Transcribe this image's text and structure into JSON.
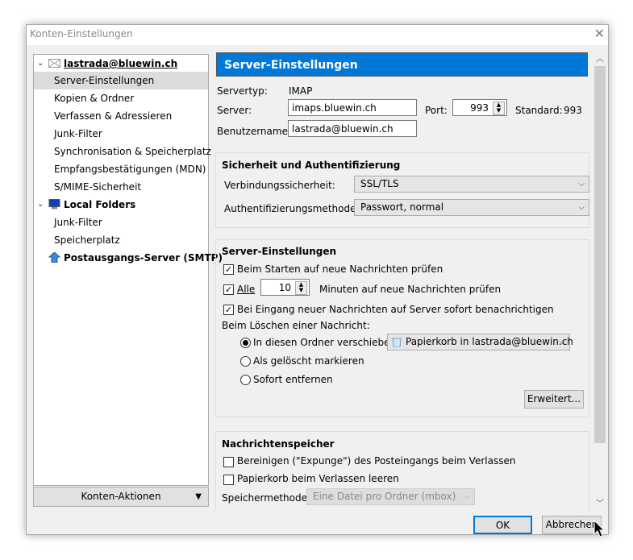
{
  "window": {
    "title": "Konten-Einstellungen",
    "close_icon": "close-icon"
  },
  "tree": {
    "items": [
      {
        "label": "lastrada@bluewin.ch",
        "type": "account",
        "icon": "envelope-icon"
      },
      {
        "label": "Server-Einstellungen",
        "selected": true
      },
      {
        "label": "Kopien & Ordner"
      },
      {
        "label": "Verfassen & Adressieren"
      },
      {
        "label": "Junk-Filter"
      },
      {
        "label": "Synchronisation & Speicherplatz"
      },
      {
        "label": "Empfangsbestätigungen (MDN)"
      },
      {
        "label": "S/MIME-Sicherheit"
      },
      {
        "label": "Local Folders",
        "type": "account",
        "icon": "computer-icon"
      },
      {
        "label": "Junk-Filter"
      },
      {
        "label": "Speicherplatz"
      },
      {
        "label": "Postausgangs-Server (SMTP)",
        "type": "account",
        "icon": "outgoing-server-icon"
      }
    ]
  },
  "account_actions": "Konten-Aktionen",
  "main": {
    "header": "Server-Einstellungen",
    "servertyp_label": "Servertyp:",
    "servertyp": "IMAP",
    "server_label": "Server:",
    "server": "imaps.bluewin.ch",
    "port_label": "Port:",
    "port": "993",
    "standard_label": "Standard:",
    "standard": "993",
    "user_label": "Benutzername:",
    "user": "lastrada@bluewin.ch",
    "security": {
      "title": "Sicherheit und Authentifizierung",
      "conn_label": "Verbindungssicherheit:",
      "conn": "SSL/TLS",
      "auth_label": "Authentifizierungsmethode:",
      "auth": "Passwort, normal"
    },
    "server_settings": {
      "title": "Server-Einstellungen",
      "check_startup": "Beim Starten auf neue Nachrichten prüfen",
      "check_startup_checked": true,
      "every": "Alle",
      "every_checked": true,
      "minutes": "10",
      "minutes_suffix": "Minuten auf neue Nachrichten prüfen",
      "idle": "Bei Eingang neuer Nachrichten auf Server sofort benachrichtigen",
      "idle_checked": true,
      "delete_label": "Beim Löschen einer Nachricht:",
      "move": "In diesen Ordner verschieben:",
      "move_folder": "Papierkorb in lastrada@bluewin.ch",
      "mark": "Als gelöscht markieren",
      "remove": "Sofort entfernen",
      "selected_option": "move",
      "advanced": "Erweitert..."
    },
    "storage": {
      "title": "Nachrichtenspeicher",
      "expunge": "Bereinigen (\"Expunge\") des Posteingangs beim Verlassen",
      "empty_trash": "Papierkorb beim Verlassen leeren",
      "method_label": "Speichermethode:",
      "method": "Eine Datei pro Ordner (mbox)"
    }
  },
  "buttons": {
    "ok": "OK",
    "cancel": "Abbrechen"
  },
  "colors": {
    "accent": "#0078d7"
  }
}
